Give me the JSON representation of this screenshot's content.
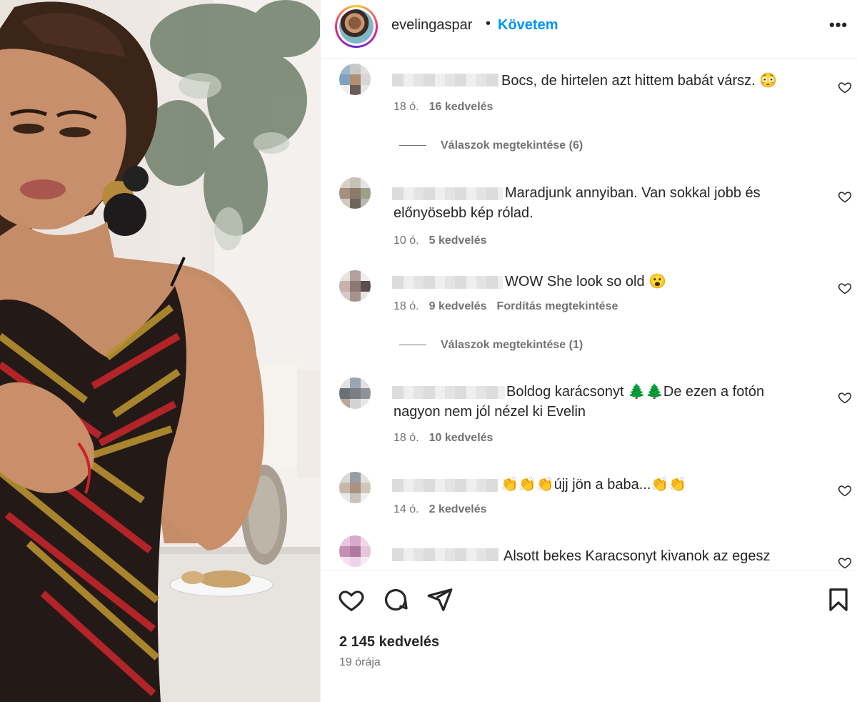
{
  "post": {
    "username": "evelingaspar",
    "separator": "•",
    "follow_label": "Követem",
    "more_label": "•••",
    "likes": "2 145 kedvelés",
    "time": "19 órája"
  },
  "comments": [
    {
      "text": "Bocs, de hirtelen azt hittem babát vársz.",
      "emoji": "😳",
      "time": "18 ó.",
      "likes": "16 kedvelés",
      "translate": "",
      "replies": "Válaszok megtekintése (6)"
    },
    {
      "text": "Maradjunk annyiban. Van sokkal jobb és előnyösebb kép rólad.",
      "emoji": "",
      "time": "10 ó.",
      "likes": "5 kedvelés",
      "translate": "",
      "replies": ""
    },
    {
      "text": "WOW She look so old",
      "emoji": "😮",
      "time": "18 ó.",
      "likes": "9 kedvelés",
      "translate": "Fordítás megtekintése",
      "replies": "Válaszok megtekintése (1)"
    },
    {
      "text_a": "Boldog karácsonyt",
      "emoji": "🌲🌲",
      "text_b": "De ezen a fotón nagyon nem jól nézel ki Evelin",
      "time": "18 ó.",
      "likes": "10 kedvelés",
      "translate": "",
      "replies": ""
    },
    {
      "emoji_a": "👏👏👏",
      "text": "újj jön a baba...",
      "emoji_b": "👏👏",
      "time": "14 ó.",
      "likes": "2 kedvelés",
      "translate": "",
      "replies": ""
    },
    {
      "text": "Alsott bekes Karacsonyt kivanok az egesz",
      "emoji": "",
      "time": "",
      "likes": "",
      "translate": "",
      "replies": ""
    }
  ],
  "icons": {
    "like": "heart-icon",
    "comment": "comment-icon",
    "share": "share-icon",
    "save": "bookmark-icon",
    "comment_like": "heart-icon"
  },
  "colors": {
    "accent": "#0095f6",
    "text": "#262626",
    "muted": "#737373"
  }
}
